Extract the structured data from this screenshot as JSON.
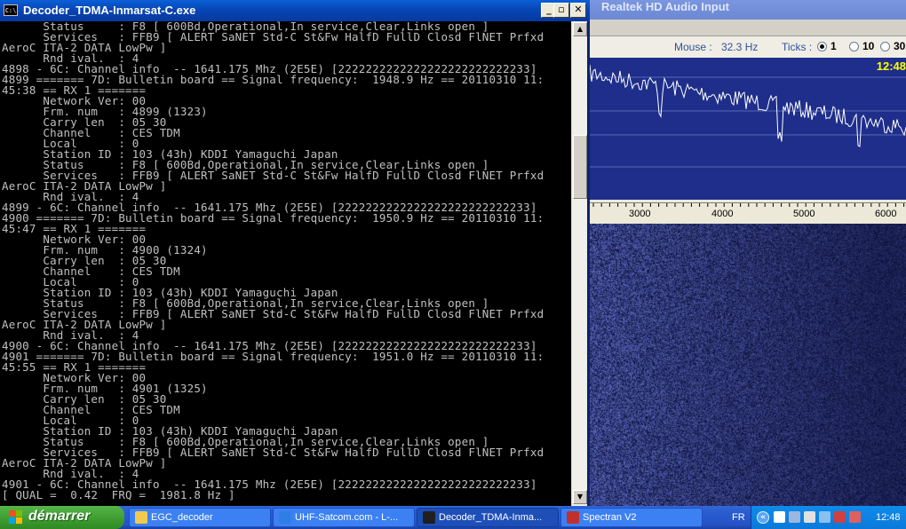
{
  "console": {
    "title": "Decoder_TDMA-Inmarsat-C.exe",
    "lines": [
      "      Status     : F8 [ 600Bd,Operational,In service,Clear,Links open ]",
      "      Services   : FFB9 [ ALERT SaNET Std-C St&Fw HalfD FullD Closd FlNET Prfxd",
      "AeroC ITA-2 DATA LowPw ]",
      "      Rnd ival.  : 4",
      "4898 - 6C: Channel info  -- 1641.175 Mhz (2E5E) [2222222222222222222222222233]",
      "4899 ======= 7D: Bulletin board == Signal frequency:  1948.9 Hz == 20110310 11:",
      "45:38 == RX 1 =======",
      "      Network Ver: 00",
      "      Frm. num   : 4899 (1323)",
      "      Carry len  : 05 30",
      "      Channel    : CES TDM",
      "      Local      : 0",
      "      Station ID : 103 (43h) KDDI Yamaguchi Japan",
      "      Status     : F8 [ 600Bd,Operational,In service,Clear,Links open ]",
      "      Services   : FFB9 [ ALERT SaNET Std-C St&Fw HalfD FullD Closd FlNET Prfxd",
      "AeroC ITA-2 DATA LowPw ]",
      "      Rnd ival.  : 4",
      "4899 - 6C: Channel info  -- 1641.175 Mhz (2E5E) [2222222222222222222222222233]",
      "4900 ======= 7D: Bulletin board == Signal frequency:  1950.9 Hz == 20110310 11:",
      "45:47 == RX 1 =======",
      "      Network Ver: 00",
      "      Frm. num   : 4900 (1324)",
      "      Carry len  : 05 30",
      "      Channel    : CES TDM",
      "      Local      : 0",
      "      Station ID : 103 (43h) KDDI Yamaguchi Japan",
      "      Status     : F8 [ 600Bd,Operational,In service,Clear,Links open ]",
      "      Services   : FFB9 [ ALERT SaNET Std-C St&Fw HalfD FullD Closd FlNET Prfxd",
      "AeroC ITA-2 DATA LowPw ]",
      "      Rnd ival.  : 4",
      "4900 - 6C: Channel info  -- 1641.175 Mhz (2E5E) [2222222222222222222222222233]",
      "4901 ======= 7D: Bulletin board == Signal frequency:  1951.0 Hz == 20110310 11:",
      "45:55 == RX 1 =======",
      "      Network Ver: 00",
      "      Frm. num   : 4901 (1325)",
      "      Carry len  : 05 30",
      "      Channel    : CES TDM",
      "      Local      : 0",
      "      Station ID : 103 (43h) KDDI Yamaguchi Japan",
      "      Status     : F8 [ 600Bd,Operational,In service,Clear,Links open ]",
      "      Services   : FFB9 [ ALERT SaNET Std-C St&Fw HalfD FullD Closd FlNET Prfxd",
      "AeroC ITA-2 DATA LowPw ]",
      "      Rnd ival.  : 4",
      "4901 - 6C: Channel info  -- 1641.175 Mhz (2E5E) [2222222222222222222222222233]",
      "[ QUAL =  0.42  FRQ =  1981.8 Hz ]"
    ],
    "buttons": {
      "minimize": "_",
      "maximize": "▫",
      "close": "✕"
    }
  },
  "spectran": {
    "title": "Realtek HD Audio Input",
    "mouse_label": "Mouse :",
    "mouse_value": "32.3 Hz",
    "ticks_label": "Ticks :",
    "ticks_options": [
      "1",
      "10",
      "30"
    ],
    "ticks_selected": "1",
    "time": "12:48",
    "freq_ticks": [
      "3000",
      "4000",
      "5000",
      "6000"
    ]
  },
  "taskbar": {
    "start_label": "démarrer",
    "tasks": [
      {
        "label": "EGC_decoder",
        "icon_color": "#f2c94c"
      },
      {
        "label": "UHF-Satcom.com - L-...",
        "icon_color": "#2f7ee6"
      },
      {
        "label": "Decoder_TDMA-Inma...",
        "icon_color": "#202020"
      },
      {
        "label": "Spectran V2",
        "icon_color": "#c03030"
      }
    ],
    "language": "FR",
    "clock": "12:48"
  },
  "colors": {
    "console_bg": "#000000",
    "console_fg": "#c0c0c0",
    "plot_bg": "#1e2e8a",
    "time_color": "#ffff00",
    "taskbar": "#245edb",
    "start_green": "#3c9b2f"
  }
}
